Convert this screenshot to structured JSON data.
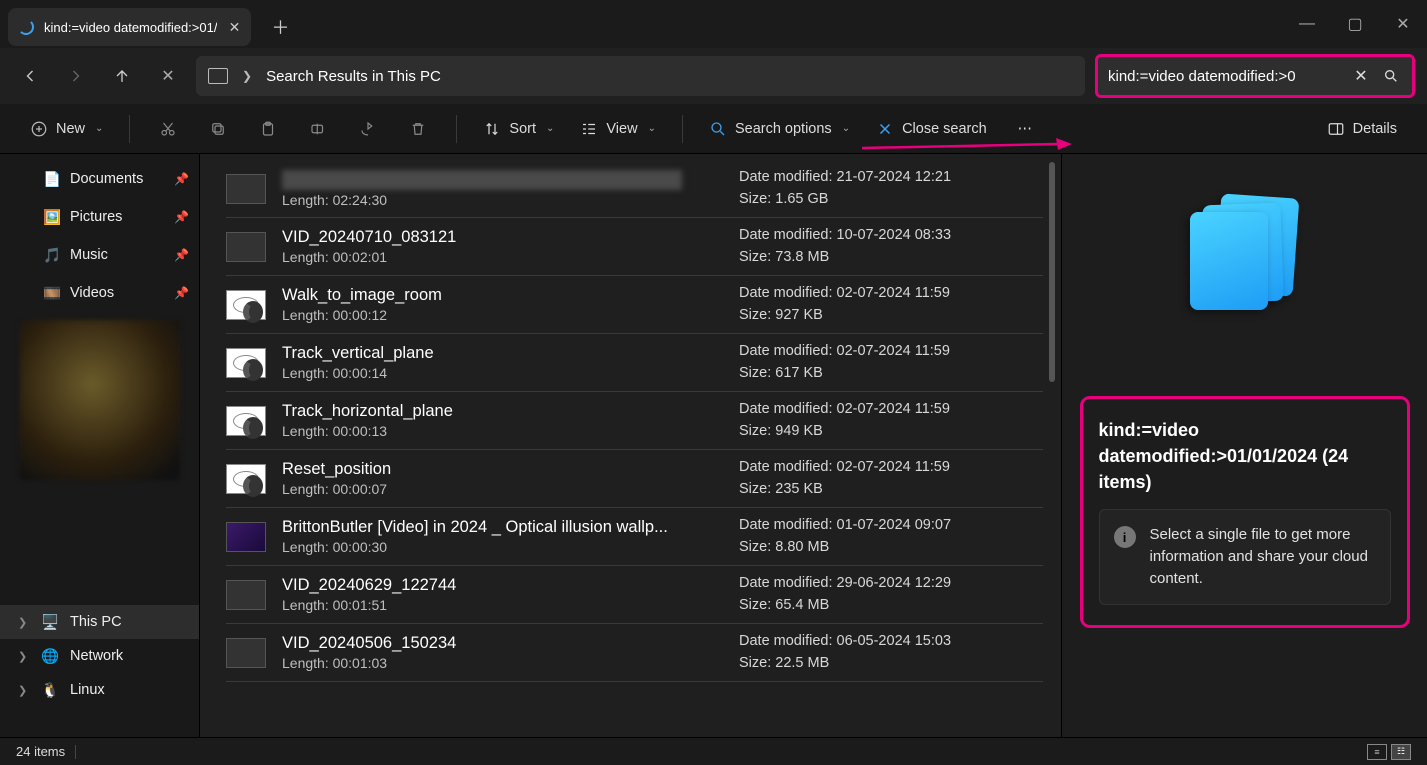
{
  "tab": {
    "title": "kind:=video datemodified:>01/"
  },
  "address": {
    "location": "Search Results in This PC"
  },
  "search": {
    "query": "kind:=video datemodified:>0"
  },
  "toolbar": {
    "new": "New",
    "sort": "Sort",
    "view": "View",
    "search_options": "Search options",
    "close_search": "Close search",
    "details": "Details"
  },
  "sidebar": {
    "quick": [
      {
        "label": "Documents"
      },
      {
        "label": "Pictures"
      },
      {
        "label": "Music"
      },
      {
        "label": "Videos"
      }
    ],
    "tree": [
      {
        "label": "This PC",
        "selected": true
      },
      {
        "label": "Network"
      },
      {
        "label": "Linux"
      }
    ]
  },
  "files": [
    {
      "name": "",
      "length": "02:24:30",
      "date": "21-07-2024 12:21",
      "size": "1.65 GB",
      "thumb": "dark"
    },
    {
      "name": "VID_20240710_083121",
      "length": "00:02:01",
      "date": "10-07-2024 08:33",
      "size": "73.8 MB",
      "thumb": "dark"
    },
    {
      "name": "Walk_to_image_room",
      "length": "00:00:12",
      "date": "02-07-2024 11:59",
      "size": "927 KB",
      "thumb": "playicon"
    },
    {
      "name": "Track_vertical_plane",
      "length": "00:00:14",
      "date": "02-07-2024 11:59",
      "size": "617 KB",
      "thumb": "playicon"
    },
    {
      "name": "Track_horizontal_plane",
      "length": "00:00:13",
      "date": "02-07-2024 11:59",
      "size": "949 KB",
      "thumb": "playicon"
    },
    {
      "name": "Reset_position",
      "length": "00:00:07",
      "date": "02-07-2024 11:59",
      "size": "235 KB",
      "thumb": "playicon"
    },
    {
      "name": "BrittonButler [Video] in 2024 _ Optical illusion wallp...",
      "length": "00:00:30",
      "date": "01-07-2024 09:07",
      "size": "8.80 MB",
      "thumb": "img"
    },
    {
      "name": "VID_20240629_122744",
      "length": "00:01:51",
      "date": "29-06-2024 12:29",
      "size": "65.4 MB",
      "thumb": "dark"
    },
    {
      "name": "VID_20240506_150234",
      "length": "00:01:03",
      "date": "06-05-2024 15:03",
      "size": "22.5 MB",
      "thumb": "dark"
    }
  ],
  "labels": {
    "length_prefix": "Length: ",
    "date_prefix": "Date modified: ",
    "size_prefix": "Size: "
  },
  "details": {
    "title": "kind:=video datemodified:>01/01/2024 (24 items)",
    "hint": "Select a single file to get more information and share your cloud content."
  },
  "status": {
    "text": "24 items"
  }
}
